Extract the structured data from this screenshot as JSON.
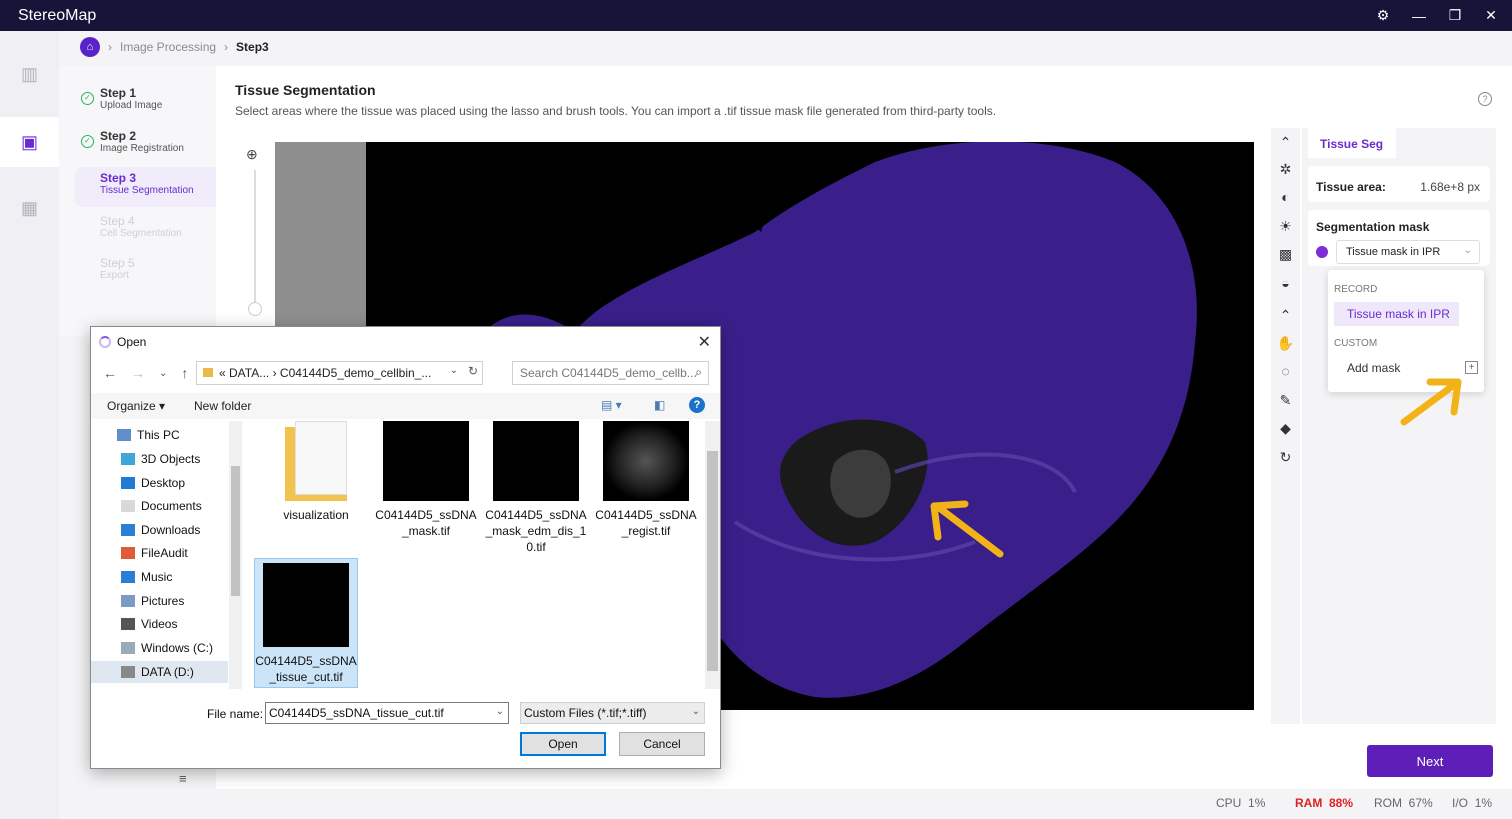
{
  "app": {
    "title": "StereoMap"
  },
  "window_controls": {
    "settings_icon": "gear-icon",
    "minimize": "—",
    "restore": "❐",
    "close": "✕"
  },
  "breadcrumb": {
    "items": [
      "Image Processing",
      "Step3"
    ]
  },
  "steps": [
    {
      "title": "Step 1",
      "sub": "Upload Image",
      "state": "done"
    },
    {
      "title": "Step 2",
      "sub": "Image Registration",
      "state": "done"
    },
    {
      "title": "Step 3",
      "sub": "Tissue Segmentation",
      "state": "active"
    },
    {
      "title": "Step 4",
      "sub": "Cell Segmentation",
      "state": "disabled"
    },
    {
      "title": "Step 5",
      "sub": "Export",
      "state": "disabled"
    }
  ],
  "main": {
    "title": "Tissue Segmentation",
    "description": "Select areas where the tissue was placed using the lasso and brush tools. You can import a .tif tissue mask file generated from third-party tools."
  },
  "props": {
    "tab": "Tissue Seg",
    "tissue_area_label": "Tissue area:",
    "tissue_area_value": "1.68e+8 px",
    "seg_mask_label": "Segmentation mask",
    "seg_mask_selected": "Tissue mask in IPR",
    "mask_color": "#7a2dd9"
  },
  "dropdown": {
    "record_label": "RECORD",
    "record_option": "Tissue mask in IPR",
    "custom_label": "CUSTOM",
    "add_mask": "Add mask"
  },
  "next_button": "Next",
  "status": {
    "cpu_label": "CPU",
    "cpu": "1%",
    "ram_label": "RAM",
    "ram": "88%",
    "rom_label": "ROM",
    "rom": "67%",
    "io_label": "I/O",
    "io": "1%"
  },
  "dialog": {
    "title": "Open",
    "address": "« DATA... › C04144D5_demo_cellbin_...",
    "search_placeholder": "Search C04144D5_demo_cellb...",
    "organize": "Organize ▾",
    "new_folder": "New folder",
    "tree": [
      "This PC",
      "3D Objects",
      "Desktop",
      "Documents",
      "Downloads",
      "FileAudit",
      "Music",
      "Pictures",
      "Videos",
      "Windows (C:)",
      "DATA (D:)"
    ],
    "files": [
      {
        "name": "visualization",
        "kind": "folder"
      },
      {
        "name": "C04144D5_ssDNA_mask.tif",
        "kind": "image"
      },
      {
        "name": "C04144D5_ssDNA_mask_edm_dis_10.tif",
        "kind": "image"
      },
      {
        "name": "C04144D5_ssDNA_regist.tif",
        "kind": "image"
      },
      {
        "name": "C04144D5_ssDNA_tissue_cut.tif",
        "kind": "image",
        "selected": true
      }
    ],
    "file_name_label": "File name:",
    "file_name_value": "C04144D5_ssDNA_tissue_cut.tif",
    "file_type": "Custom Files (*.tif;*.tiff)",
    "open": "Open",
    "cancel": "Cancel"
  },
  "colors": {
    "accent": "#5d1fb8",
    "titlebar": "#17143a",
    "tissue": "#3a1f8a",
    "arrow": "#f2b318"
  }
}
